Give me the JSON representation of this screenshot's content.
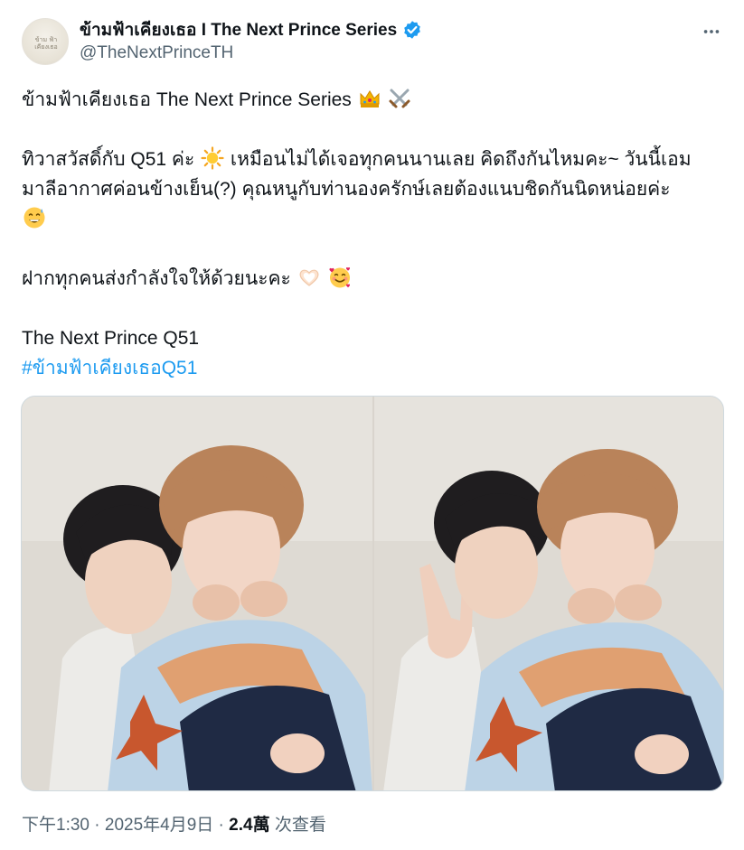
{
  "author": {
    "display_name": "ข้ามฟ้าเคียงเธอ I The Next Prince Series",
    "handle": "@TheNextPrinceTH",
    "verified": true,
    "avatar_logo_text": "ข้ามฟ้าเคียงเธอ"
  },
  "tweet": {
    "line1": "ข้ามฟ้าเคียงเธอ The Next Prince Series",
    "line1_emojis": [
      "crown-emoji",
      "crossed-swords-emoji"
    ],
    "line2": "ทิวาสวัสดิ์กับ Q51 ค่ะ",
    "line2_emoji": "sun-emoji",
    "line2_rest": "เหมือนไม่ได้เจอทุกคนนานเลย คิดถึงกันไหมคะ~ วันนี้เอม",
    "line3": "มาลีอากาศค่อนข้างเย็น(?) คุณหนูกับท่านองครักษ์เลยต้องแนบชิดกันนิดหน่อยค่ะ",
    "line4_emoji": "grinning-sweat-emoji",
    "line5": "ฝากทุกคนส่งกำลังใจให้ด้วยนะคะ",
    "line5_emojis": [
      "heart-hands-emoji",
      "smiling-hearts-emoji"
    ],
    "line6": "The Next Prince Q51",
    "hashtag": "#ข้ามฟ้าเคียงเธอQ51"
  },
  "media": {
    "photos": [
      "photo-1",
      "photo-2"
    ]
  },
  "meta": {
    "time": "下午1:30",
    "separator1": " · ",
    "date": "2025年4月9日",
    "separator2": " · ",
    "views_count": "2.4萬",
    "views_label": " 次查看"
  },
  "colors": {
    "link": "#1d9bf0",
    "secondary_text": "#536471",
    "primary_text": "#0f1419",
    "verified": "#1d9bf0",
    "border": "#cfd9de"
  }
}
